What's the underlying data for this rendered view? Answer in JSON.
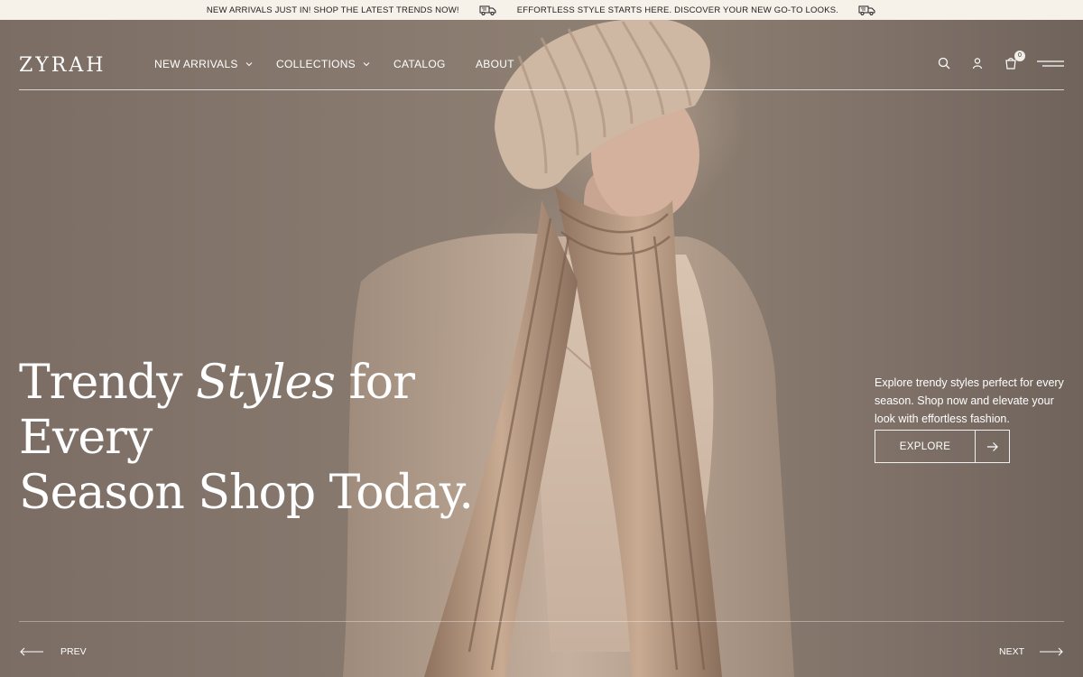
{
  "announcement": {
    "messages": [
      "NEW ARRIVALS JUST IN! SHOP THE LATEST TRENDS NOW!",
      "EFFORTLESS STYLE STARTS HERE. DISCOVER YOUR NEW GO-TO LOOKS."
    ],
    "icon": "truck-icon"
  },
  "header": {
    "logo": "ZYRAH",
    "nav": [
      {
        "label": "NEW ARRIVALS",
        "dropdown": true
      },
      {
        "label": "COLLECTIONS",
        "dropdown": true
      },
      {
        "label": "CATALOG",
        "dropdown": false
      },
      {
        "label": "ABOUT",
        "dropdown": false
      }
    ],
    "icons": [
      "search-icon",
      "account-icon",
      "cart-icon",
      "menu-icon"
    ],
    "cart_count": "0"
  },
  "hero": {
    "headline_pre": "Trendy ",
    "headline_ital": "Styles",
    "headline_post": " for Every",
    "headline_line2": "Season Shop Today.",
    "description": "Explore trendy styles perfect for every season. Shop now and elevate your look with effortless fashion.",
    "cta_label": "EXPLORE"
  },
  "slider": {
    "prev_label": "PREV",
    "next_label": "NEXT"
  },
  "colors": {
    "announcement_bg": "#f6f1e9",
    "hero_bg": "#7d6f66",
    "text": "#ffffff"
  }
}
